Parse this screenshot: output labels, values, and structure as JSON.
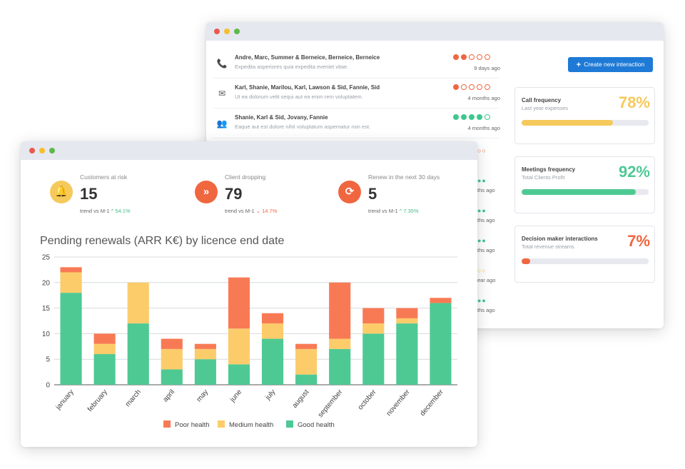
{
  "back_window": {
    "interactions": [
      {
        "icon": "phone-icon",
        "glyph": "📞",
        "names": "Andre, Marc, Summer & Berneice, Berneice, Berneice",
        "desc": "Expedita asperiores quia expedita eveniet vitae.",
        "health": [
          1,
          1,
          0,
          0,
          0
        ],
        "color": "#f0663f",
        "ago": "9 days ago"
      },
      {
        "icon": "envelope-icon",
        "glyph": "✉",
        "names": "Karl, Shanie, Marilou, Karl, Lawson & Sid, Fannie, Sid",
        "desc": "Ut ea dolorum velit sequi aut ea enim rem voluptatem.",
        "health": [
          1,
          0,
          0,
          0,
          0
        ],
        "color": "#f0663f",
        "ago": "4 months ago"
      },
      {
        "icon": "users-icon",
        "glyph": "👥",
        "names": "Shanie, Karl & Sid, Jovany, Fannie",
        "desc": "Eaque aut est dolore nihil voluptatum aspernatur non est.",
        "health": [
          1,
          1,
          1,
          1,
          0
        ],
        "color": "#3ec88f",
        "ago": "4 months ago"
      }
    ],
    "partial_rows": [
      {
        "health": "○○",
        "color": "#f0663f",
        "ago": ""
      },
      {
        "health": "●●",
        "color": "#3ec88f",
        "ago": "ths ago"
      },
      {
        "health": "●●",
        "color": "#3ec88f",
        "ago": "ths ago"
      },
      {
        "health": "●●",
        "color": "#3ec88f",
        "ago": "ths ago"
      },
      {
        "health": "○○",
        "color": "#f5c95b",
        "ago": "ear ago"
      },
      {
        "health": "●●",
        "color": "#3ec88f",
        "ago": "ths ago"
      },
      {
        "health": "○○",
        "color": "#f0663f",
        "ago": "ear ago"
      }
    ],
    "create_button": "Create new interaction",
    "kpis": [
      {
        "title": "Call frequency",
        "subtitle": "Last year expenses",
        "percent": "78%",
        "value": 0.72,
        "color": "#f5c95b"
      },
      {
        "title": "Meetings frequency",
        "subtitle": "Total Clients Profit",
        "percent": "92%",
        "value": 0.9,
        "color": "#4ec994"
      },
      {
        "title": "Decision maker interactions",
        "subtitle": "Total revenue streams",
        "percent": "7%",
        "value": 0.07,
        "color": "#f0663f"
      }
    ]
  },
  "front_window": {
    "stats": [
      {
        "label": "Customers at risk",
        "value": "15",
        "trend_label": "trend vs M-1",
        "trend": "^ 54.1%",
        "dir": "up",
        "color": "#f5c95b",
        "glyph": "🔔",
        "icon": "bell-icon"
      },
      {
        "label": "Client dropping",
        "value": "79",
        "trend_label": "trend vs M-1",
        "trend": "⌄ 14.7%",
        "dir": "dn",
        "color": "#f0663f",
        "glyph": "»",
        "icon": "double-chevron-down-icon"
      },
      {
        "label": "Renew in the next 30 days",
        "value": "5",
        "trend_label": "trend vs M-1",
        "trend": "^ 7.35%",
        "dir": "up",
        "color": "#f0663f",
        "glyph": "⟳",
        "icon": "refresh-icon"
      }
    ],
    "chart_title": "Pending renewals (ARR K€) by licence end date"
  },
  "chart_data": {
    "type": "bar",
    "stacked": true,
    "title": "Pending renewals (ARR K€) by licence end date",
    "categories": [
      "january",
      "february",
      "march",
      "april",
      "may",
      "june",
      "july",
      "august",
      "september",
      "october",
      "november",
      "december"
    ],
    "series": [
      {
        "name": "Good health",
        "color": "#4ec994",
        "values": [
          18,
          6,
          12,
          3,
          5,
          4,
          9,
          2,
          7,
          10,
          12,
          16
        ]
      },
      {
        "name": "Medium health",
        "color": "#fccc6b",
        "values": [
          4,
          2,
          8,
          4,
          2,
          7,
          3,
          5,
          2,
          2,
          1,
          0
        ]
      },
      {
        "name": "Poor health",
        "color": "#f87a55",
        "values": [
          1,
          2,
          0,
          2,
          1,
          10,
          2,
          1,
          11,
          3,
          2,
          1
        ]
      }
    ],
    "legend_order": [
      "Poor health",
      "Medium health",
      "Good health"
    ],
    "ylim": [
      0,
      25
    ],
    "yticks": [
      0,
      5,
      10,
      15,
      20,
      25
    ],
    "grid": true,
    "legend_position": "bottom"
  }
}
